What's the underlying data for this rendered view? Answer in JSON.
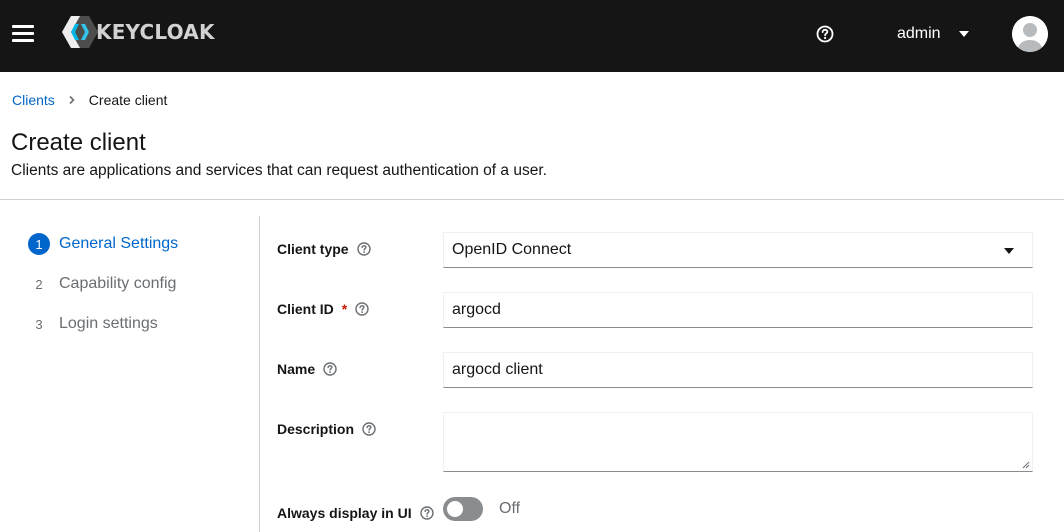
{
  "header": {
    "brand": "KEYCLOAK",
    "user": "admin"
  },
  "breadcrumb": {
    "parent": "Clients",
    "current": "Create client"
  },
  "page": {
    "title": "Create client",
    "description": "Clients are applications and services that can request authentication of a user."
  },
  "wizard": {
    "steps": [
      {
        "num": "1",
        "label": "General Settings",
        "active": true
      },
      {
        "num": "2",
        "label": "Capability config",
        "active": false
      },
      {
        "num": "3",
        "label": "Login settings",
        "active": false
      }
    ]
  },
  "form": {
    "client_type": {
      "label": "Client type",
      "value": "OpenID Connect"
    },
    "client_id": {
      "label": "Client ID",
      "required_mark": "*",
      "value": "argocd"
    },
    "name": {
      "label": "Name",
      "value": "argocd client"
    },
    "description": {
      "label": "Description",
      "value": ""
    },
    "always_display": {
      "label": "Always display in UI",
      "state": "Off"
    }
  },
  "colors": {
    "masthead": "#151515",
    "accent": "#0066cc",
    "required": "#c9190b"
  }
}
